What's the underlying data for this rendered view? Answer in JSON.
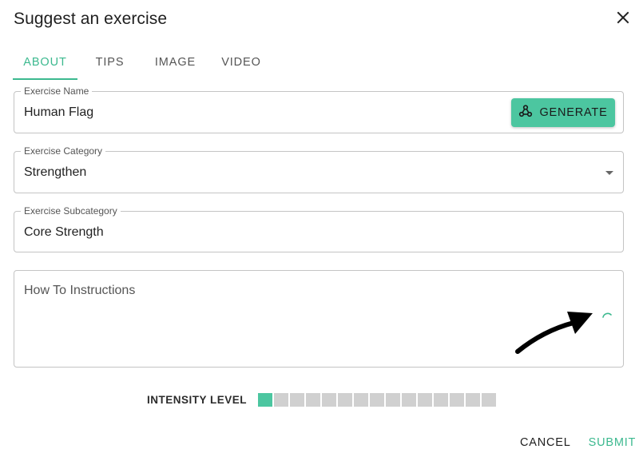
{
  "dialog": {
    "title": "Suggest an exercise",
    "close_icon": "close-icon"
  },
  "tabs": [
    {
      "label": "ABOUT",
      "active": true
    },
    {
      "label": "TIPS",
      "active": false
    },
    {
      "label": "IMAGE",
      "active": false
    },
    {
      "label": "VIDEO",
      "active": false
    }
  ],
  "form": {
    "exercise_name": {
      "label": "Exercise Name",
      "value": "Human Flag"
    },
    "generate_button": {
      "label": "GENERATE",
      "icon": "webhook-icon"
    },
    "exercise_category": {
      "label": "Exercise Category",
      "value": "Strengthen"
    },
    "exercise_subcategory": {
      "label": "Exercise Subcategory",
      "value": "Core Strength"
    },
    "how_to": {
      "placeholder": "How To Instructions",
      "loading": true
    }
  },
  "intensity": {
    "label": "INTENSITY LEVEL",
    "level": 1,
    "max": 15
  },
  "actions": {
    "cancel_label": "CANCEL",
    "submit_label": "SUBMIT"
  },
  "colors": {
    "accent": "#3cb98f",
    "button_fill": "#4cc6a0",
    "segment_off": "#d0d0d0",
    "border": "#c4c4c4"
  }
}
